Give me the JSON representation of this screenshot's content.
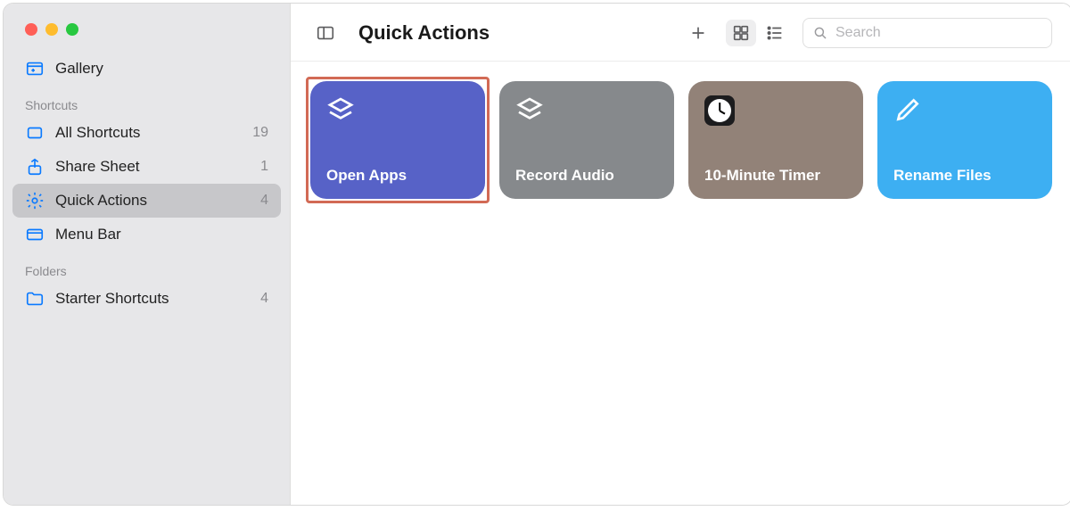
{
  "sidebar": {
    "gallery_label": "Gallery",
    "section_shortcuts": "Shortcuts",
    "section_folders": "Folders",
    "items": [
      {
        "label": "All Shortcuts",
        "count": "19"
      },
      {
        "label": "Share Sheet",
        "count": "1"
      },
      {
        "label": "Quick Actions",
        "count": "4"
      },
      {
        "label": "Menu Bar",
        "count": ""
      }
    ],
    "folders": [
      {
        "label": "Starter Shortcuts",
        "count": "4"
      }
    ]
  },
  "toolbar": {
    "title": "Quick Actions",
    "search_placeholder": "Search"
  },
  "cards": [
    {
      "title": "Open Apps"
    },
    {
      "title": "Record Audio"
    },
    {
      "title": "10-Minute Timer"
    },
    {
      "title": "Rename Files"
    }
  ]
}
